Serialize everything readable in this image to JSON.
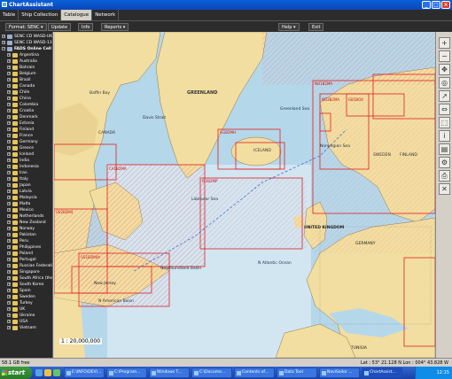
{
  "window": {
    "title": "ChartAssistant"
  },
  "tabs": [
    "Table",
    "Ship Collection",
    "Catalogue",
    "Network"
  ],
  "active_tab": 2,
  "toolbar": {
    "format": "Format: SENC",
    "update": "Update",
    "info": "Info",
    "reports": "Reports",
    "help": "Help",
    "exit": "Exit"
  },
  "tree": {
    "roots": [
      "SENC CD WASD-UK",
      "SENC CD WASD-13",
      "FADS Online Cell"
    ],
    "countries": [
      "Argentina",
      "Australia",
      "Bahrain",
      "Belgium",
      "Brazil",
      "Canada",
      "Chile",
      "China",
      "Colombia",
      "Croatia",
      "Denmark",
      "Estonia",
      "Finland",
      "France",
      "Germany",
      "Greece",
      "Iceland",
      "India",
      "Indonesia",
      "Iran",
      "Italy",
      "Japan",
      "Latvia",
      "Malaysia",
      "Malta",
      "Mexico",
      "Netherlands",
      "New Zealand",
      "Norway",
      "Pakistan",
      "Peru",
      "Philippines",
      "Poland",
      "Portugal",
      "Russian Federation",
      "Singapore",
      "South Africa (the)",
      "South Korea",
      "Spain",
      "Sweden",
      "Turkey",
      "UK",
      "Ukraine",
      "USA",
      "Vietnam"
    ]
  },
  "map": {
    "scale": "1 : 20,000,000",
    "labels": {
      "baffin": "Baffin Bay",
      "davis": "Davis Strait",
      "labrador": "Labrador Sea",
      "greenland": "Greenland Sea",
      "norwegian": "Norwegian Sea",
      "iceland": "ICELAND",
      "sweden": "SWEDEN",
      "finland": "FINLAND",
      "uk": "UNITED KINGDOM",
      "germany": "GERMANY",
      "canada": "CANADA",
      "natlantic": "N Atlantic Ocean",
      "newfoundland": "Newfoundland Basin",
      "namerica": "N American Basin",
      "newjersey": "New Jersey",
      "greenland_land": "GREENLAND",
      "tunisia": "TUNISIA",
      "cells": [
        "GB1BO4",
        "US6BB2MA",
        "NO1B2MA",
        "NO3B2MA",
        "IS1B2MH",
        "IS1B2MP",
        "US1B2M4A",
        "US2B2M4",
        "CA1B2MA"
      ]
    },
    "colors": {
      "sea": "#b5d7ea",
      "deep": "#d2e6f2",
      "land": "#f2dea0",
      "cell_border": "#e02020",
      "cell_fill": "#f4b8b8"
    }
  },
  "right_tools": [
    "zoom-in-icon",
    "zoom-out-icon",
    "pan-icon",
    "target-icon",
    "route-icon",
    "measure-icon",
    "select-icon",
    "info-icon",
    "layers-icon",
    "settings-icon",
    "print-icon",
    "close-icon"
  ],
  "status": {
    "left": "58.1 GB free",
    "right": "Lat : 53° 21.128 N Lon : 004° 43.828 W"
  },
  "taskbar": {
    "start": "start",
    "tasks": [
      "E:\\INFO\\DEV\\...",
      "C:\\Program...",
      "Windows T...",
      "C:\\Docume...",
      "Contents of...",
      "Data Tool",
      "NaviSailor ...",
      "ChartAssist..."
    ],
    "clock": "12:15"
  }
}
